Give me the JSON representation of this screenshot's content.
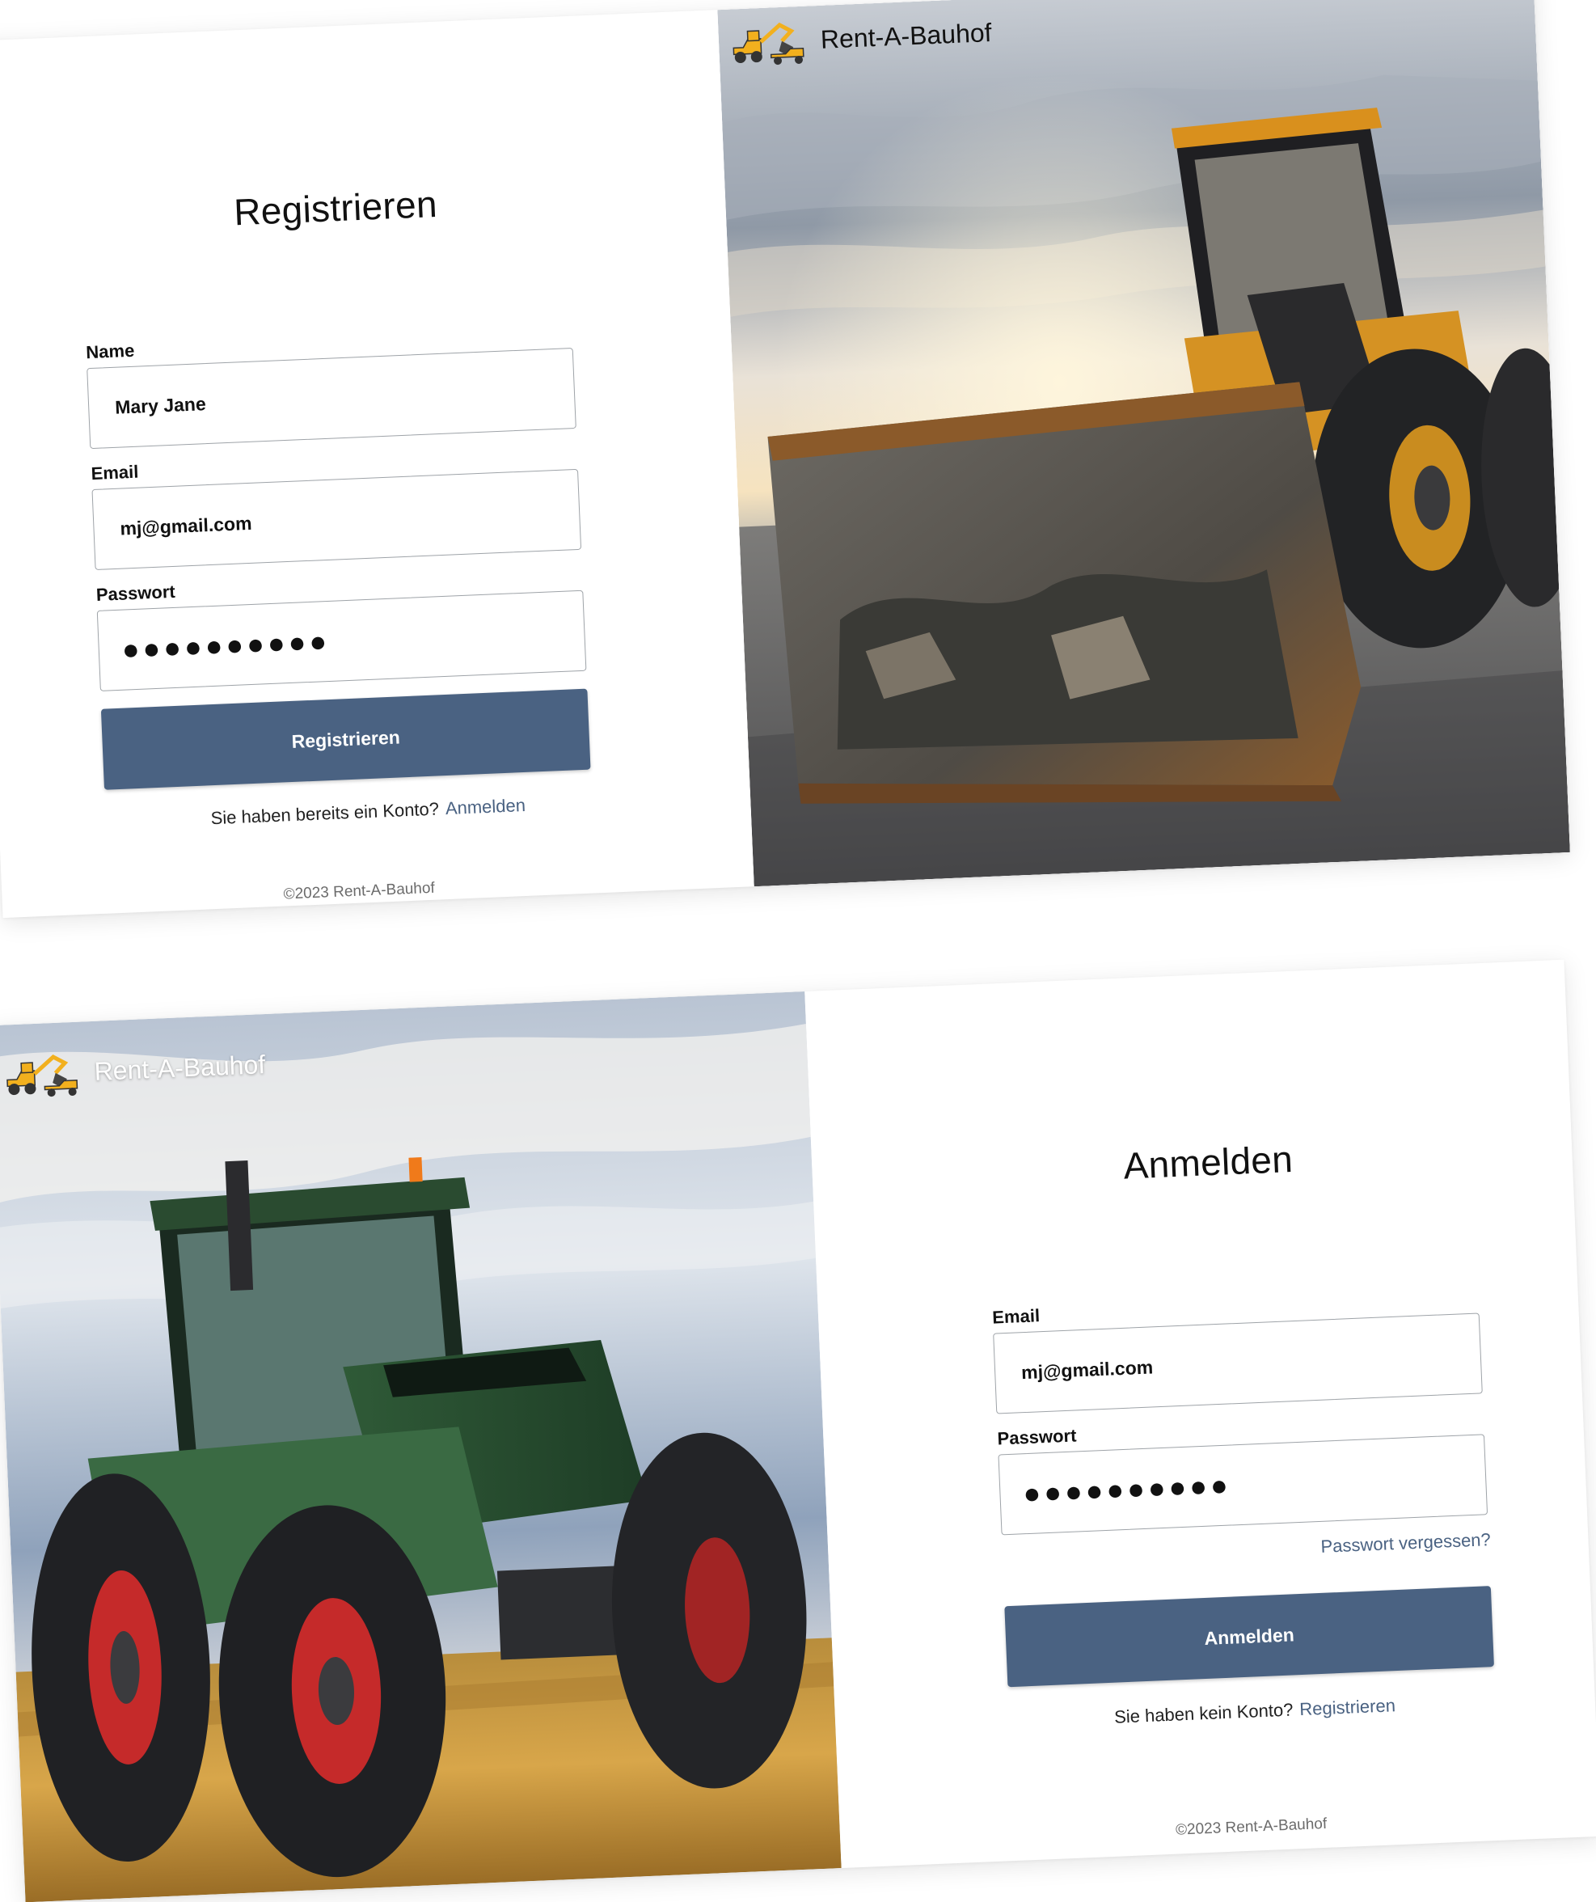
{
  "brand": {
    "name": "Rent-A-Bauhof",
    "footer": "©2023 Rent-A-Bauhof"
  },
  "register": {
    "title": "Registrieren",
    "name_label": "Name",
    "name_value": "Mary Jane",
    "email_label": "Email",
    "email_value": "mj@gmail.com",
    "password_label": "Passwort",
    "password_value": "●●●●●●●●●●",
    "submit_label": "Registrieren",
    "alt_text": "Sie haben bereits ein Konto?",
    "alt_link": "Anmelden"
  },
  "login": {
    "title": "Anmelden",
    "email_label": "Email",
    "email_value": "mj@gmail.com",
    "password_label": "Passwort",
    "password_value": "●●●●●●●●●●",
    "forgot_link": "Passwort vergessen?",
    "submit_label": "Anmelden",
    "alt_text": "Sie haben kein Konto?",
    "alt_link": "Registrieren"
  },
  "colors": {
    "accent": "#4a6282",
    "text": "#111111",
    "muted": "#6b6b6b"
  },
  "icons": {
    "brand_logo": "excavator-loader-logo-icon",
    "photo_top": "wheel-loader-photo",
    "photo_bottom": "tractor-photo"
  }
}
